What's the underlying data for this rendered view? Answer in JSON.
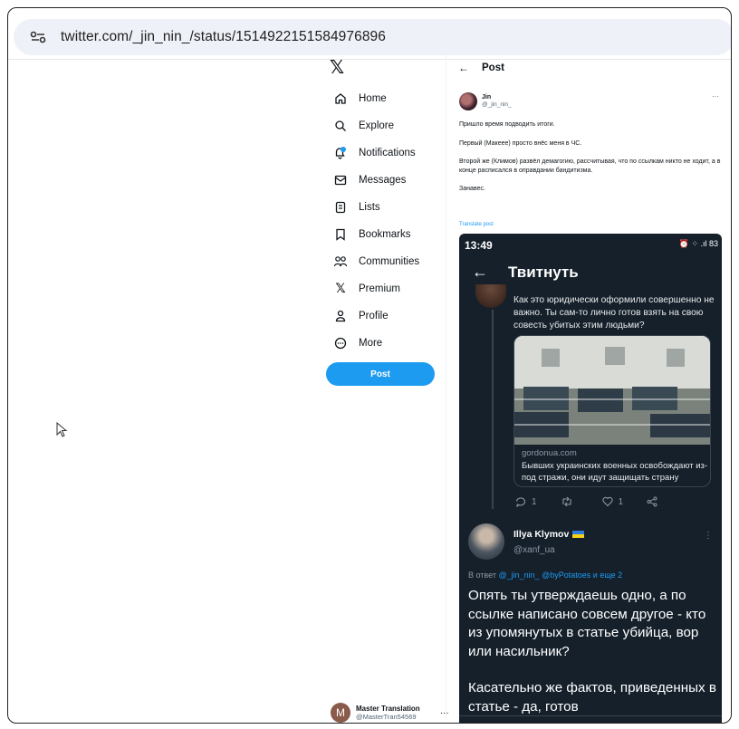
{
  "browser": {
    "url": "twitter.com/_jin_nin_/status/1514922151584976896"
  },
  "nav": {
    "items": [
      {
        "label": "Home",
        "icon": "home-icon"
      },
      {
        "label": "Explore",
        "icon": "search-icon"
      },
      {
        "label": "Notifications",
        "icon": "bell-icon"
      },
      {
        "label": "Messages",
        "icon": "envelope-icon"
      },
      {
        "label": "Lists",
        "icon": "list-icon"
      },
      {
        "label": "Bookmarks",
        "icon": "bookmark-icon"
      },
      {
        "label": "Communities",
        "icon": "people-icon"
      },
      {
        "label": "Premium",
        "icon": "x-logo-icon"
      },
      {
        "label": "Profile",
        "icon": "person-icon"
      },
      {
        "label": "More",
        "icon": "more-circle-icon"
      }
    ],
    "notifications_badge": "",
    "post_button": "Post"
  },
  "account": {
    "initial": "M",
    "name": "Master Translation",
    "handle": "@MasterTran54569"
  },
  "post": {
    "header": "Post",
    "author_name": "Jin",
    "author_handle": "@_jin_nin_",
    "paragraphs": [
      "Пришло время подводить итоги.",
      "Первый (Макеее) просто внёс меня в ЧС.",
      "Второй же (Климов) развёл демагогию, рассчитывая, что по ссылкам никто не ходит, а в конце расписался в оправдании бандитизма.",
      "Занавес."
    ],
    "translate": "Translate post"
  },
  "embedded": {
    "time": "13:49",
    "status_icons": "⏰ ⁘ .ıl 83",
    "title": "Твитнуть",
    "reply_text": "Как это юридически оформили совершенно не важно. Ты сам-то лично готов взять на свою совесть убитых этим людьми?",
    "card_domain": "gordonua.com",
    "card_headline": "Бывших украинских военных освобождают из-под стражи, они идут защищать страну",
    "reply_count": "1",
    "like_count": "1",
    "k_name": "Illya Klymov",
    "k_handle": "@xanf_ua",
    "reply_to_prefix": "В ответ",
    "reply_to_mentions": "@_jin_nin_ @byPotatoes и еще 2",
    "k_para1": "Опять ты утверждаешь одно, а по ссылке написано совсем другое - кто из упомянутых в статье убийца, вор или насильник?",
    "k_para2": "Касательно же фактов, приведенных в статье - да, готов"
  }
}
